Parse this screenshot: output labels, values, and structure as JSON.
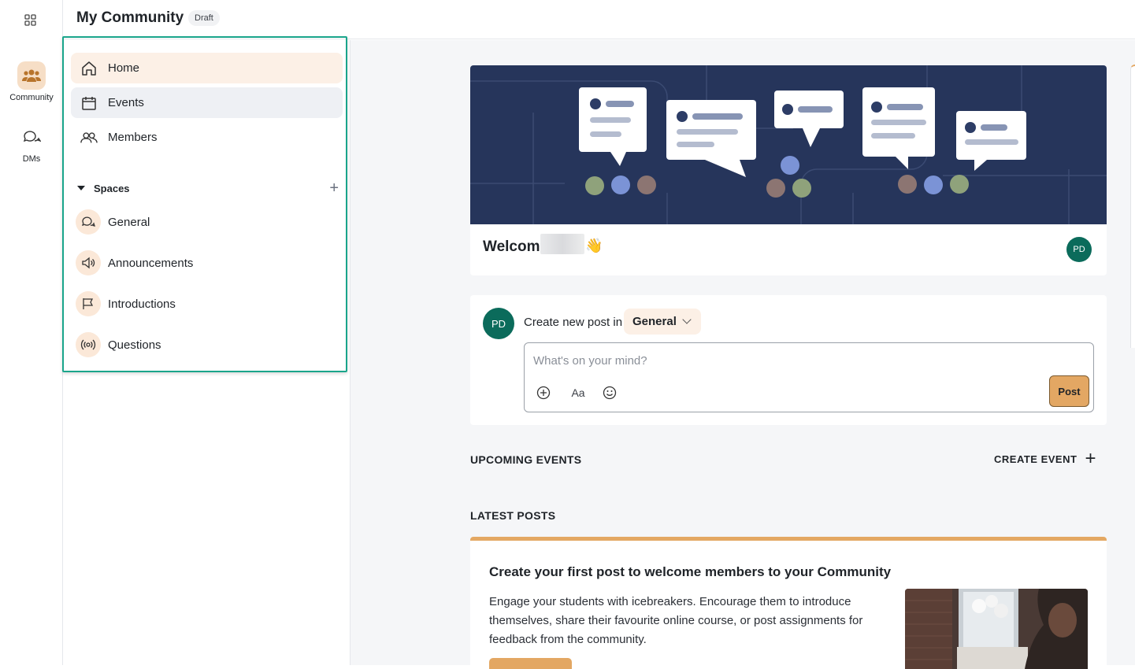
{
  "rail": {
    "items": [
      {
        "label": "Community",
        "icon": "community-icon",
        "active": true
      },
      {
        "label": "DMs",
        "icon": "dms-icon",
        "active": false
      }
    ]
  },
  "header": {
    "title": "My Community",
    "badge": "Draft"
  },
  "sidebar": {
    "nav": [
      {
        "label": "Home",
        "icon": "home-icon"
      },
      {
        "label": "Events",
        "icon": "calendar-icon"
      },
      {
        "label": "Members",
        "icon": "members-icon"
      }
    ],
    "spaces_label": "Spaces",
    "spaces_add": "+",
    "spaces": [
      {
        "label": "General",
        "icon": "chat-icon"
      },
      {
        "label": "Announcements",
        "icon": "megaphone-icon"
      },
      {
        "label": "Introductions",
        "icon": "flag-icon"
      },
      {
        "label": "Questions",
        "icon": "broadcast-icon"
      }
    ]
  },
  "welcome": {
    "text": "Welcome",
    "emoji": "👋",
    "avatar_initials": "PD"
  },
  "composer": {
    "avatar_initials": "PD",
    "prompt": "Create new post in",
    "space": "General",
    "placeholder": "What's on your mind?",
    "tools": [
      "add-icon",
      "text-format-icon",
      "emoji-icon"
    ],
    "format_label": "Aa",
    "post_label": "Post"
  },
  "events": {
    "title": "UPCOMING EVENTS",
    "create_label": "CREATE EVENT",
    "create_plus": "+"
  },
  "latest": {
    "title": "LATEST POSTS",
    "card_title": "Create your first post to welcome members to your Community",
    "card_body": "Engage your students with icebreakers. Encourage them to introduce themselves, share their favourite online course, or post assignments for feedback from the community."
  },
  "colors": {
    "accent": "#e3a763",
    "accent_light": "#fcf0e6",
    "avatar": "#0b6b5b",
    "highlight": "#1aa58b",
    "banner": "#26355b"
  }
}
